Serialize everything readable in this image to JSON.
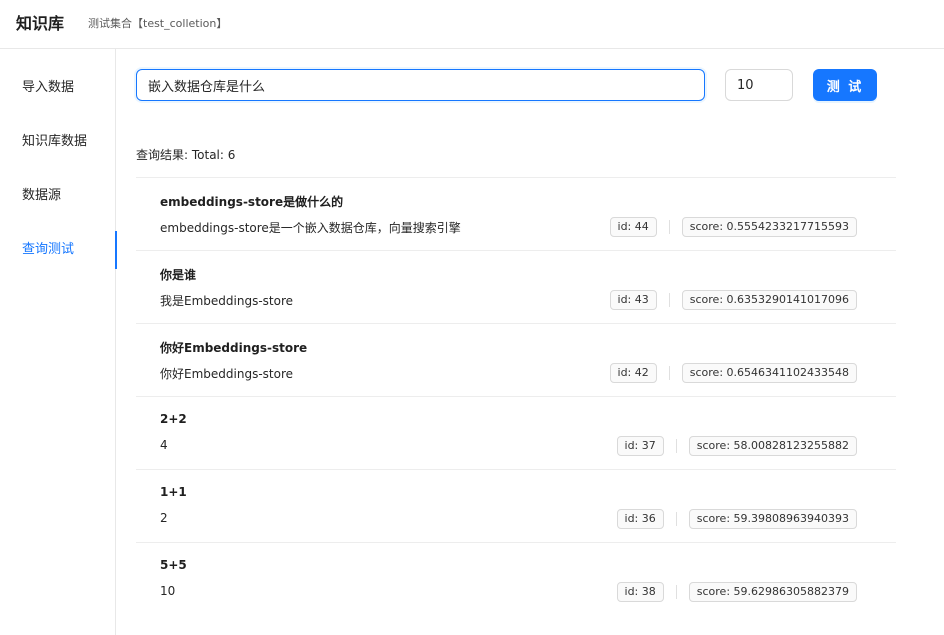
{
  "header": {
    "title": "知识库",
    "subtitle": "测试集合【test_colletion】"
  },
  "sidebar": {
    "items": [
      {
        "label": "导入数据",
        "active": false
      },
      {
        "label": "知识库数据",
        "active": false
      },
      {
        "label": "数据源",
        "active": false
      },
      {
        "label": "查询测试",
        "active": true
      }
    ]
  },
  "query": {
    "value": "嵌入数据仓库是什么",
    "top_k": "10",
    "button_label": "测 试"
  },
  "result_summary": "查询结果:  Total:  6",
  "results": [
    {
      "title": "embeddings-store是做什么的",
      "content": "embeddings-store是一个嵌入数据仓库，向量搜索引擎",
      "id": "id:  44",
      "score": "score:  0.5554233217715593"
    },
    {
      "title": "你是谁",
      "content": "我是Embeddings-store",
      "id": "id:  43",
      "score": "score:  0.6353290141017096"
    },
    {
      "title": "你好Embeddings-store",
      "content": "你好Embeddings-store",
      "id": "id:  42",
      "score": "score:  0.6546341102433548"
    },
    {
      "title": "2+2",
      "content": "4",
      "id": "id:  37",
      "score": "score:  58.00828123255882"
    },
    {
      "title": "1+1",
      "content": "2",
      "id": "id:  36",
      "score": "score:  59.39808963940393"
    },
    {
      "title": "5+5",
      "content": "10",
      "id": "id:  38",
      "score": "score:  59.62986305882379"
    }
  ],
  "colors": {
    "primary": "#1677ff",
    "border": "#e8e8e8"
  }
}
